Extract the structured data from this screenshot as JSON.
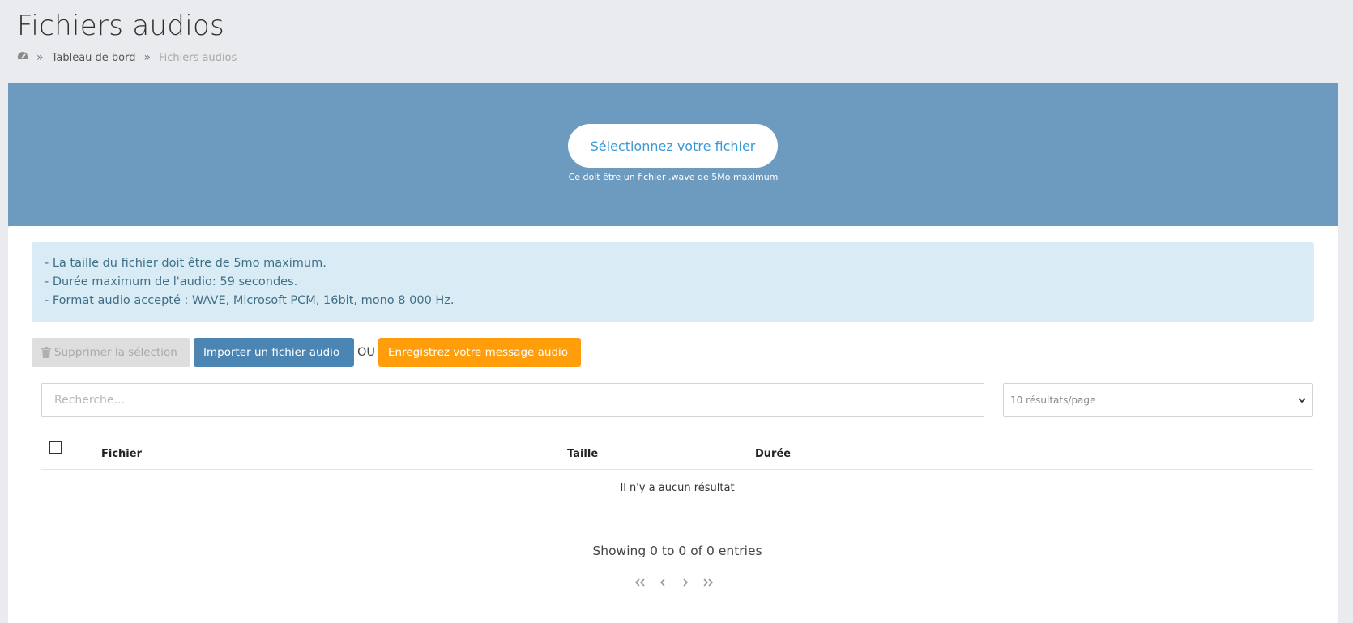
{
  "page": {
    "title": "Fichiers audios"
  },
  "breadcrumb": {
    "home_icon": "dashboard-icon",
    "separator": "»",
    "items": [
      {
        "label": "Tableau de bord"
      },
      {
        "label": "Fichiers audios"
      }
    ]
  },
  "upload": {
    "button_label": "Sélectionnez votre fichier",
    "hint_prefix": "Ce doit être un fichier ",
    "hint_link": ".wave de 5Mo maximum"
  },
  "info": {
    "lines": [
      "- La taille du fichier doit être de 5mo maximum.",
      "- Durée maximum de l'audio: 59 secondes.",
      "- Format audio accepté : WAVE, Microsoft PCM, 16bit, mono 8 000 Hz."
    ]
  },
  "actions": {
    "delete_label": "Supprimer la sélection",
    "import_label": "Importer un fichier audio",
    "or_label": "OU",
    "record_label": "Enregistrez votre message audio"
  },
  "search": {
    "placeholder": "Recherche...",
    "value": ""
  },
  "page_size": {
    "selected": "10 résultats/page"
  },
  "table": {
    "columns": [
      "Fichier",
      "Taille",
      "Durée"
    ],
    "rows": [],
    "empty_message": "Il n'y a aucun résultat"
  },
  "pagination": {
    "summary": "Showing 0 to 0 of 0 entries",
    "controls": [
      "first-page-icon",
      "previous-page-icon",
      "next-page-icon",
      "last-page-icon"
    ]
  },
  "colors": {
    "banner": "#6d9bbf",
    "import_button": "#4a85b4",
    "record_button": "#ff9d0a",
    "info_box": "#d9ecf5",
    "link_blue": "#3b99d6"
  }
}
